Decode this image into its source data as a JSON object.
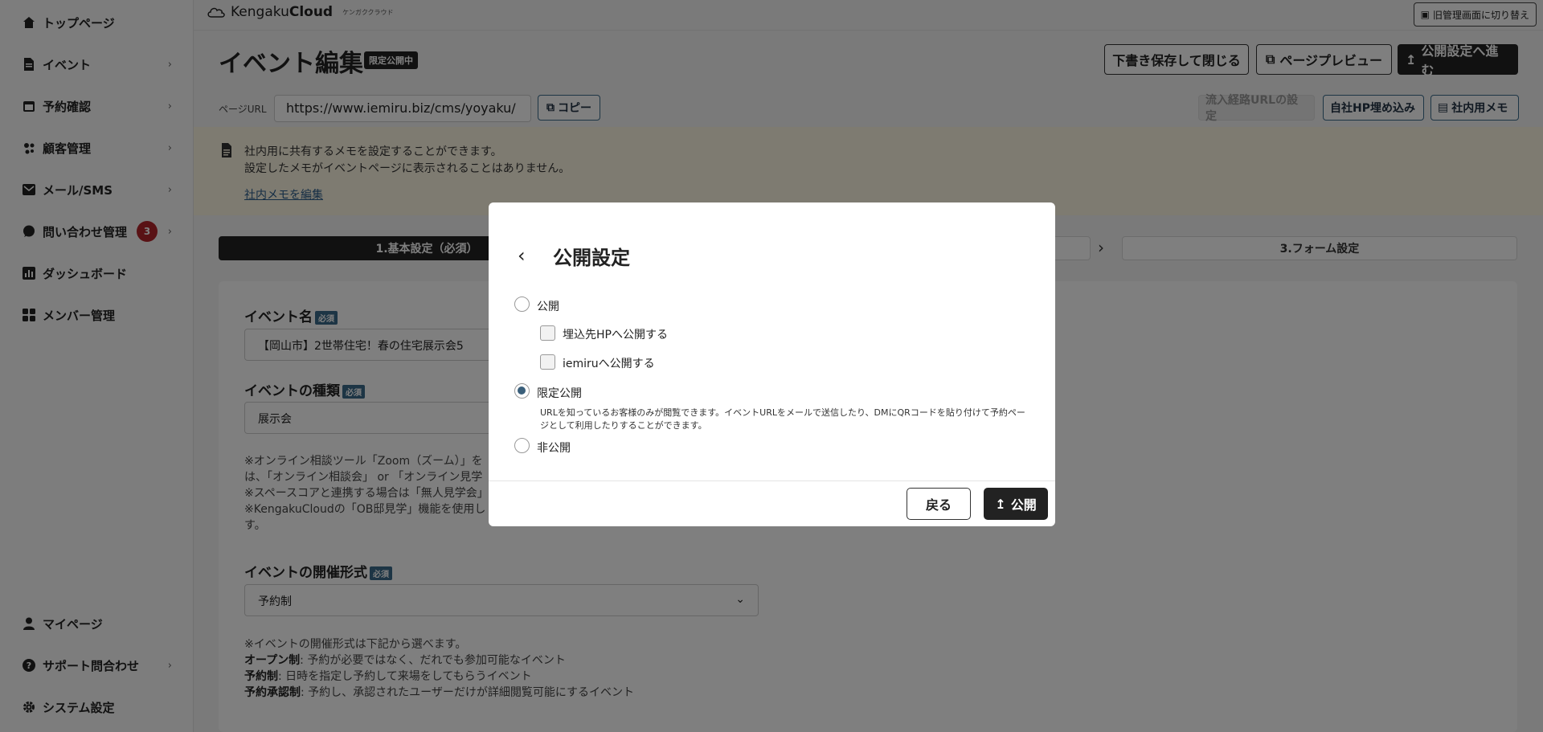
{
  "sidebar": {
    "items": [
      {
        "label": "トップページ",
        "icon": "home-icon"
      },
      {
        "label": "イベント",
        "icon": "document-icon"
      },
      {
        "label": "予約確認",
        "icon": "calendar-icon"
      },
      {
        "label": "顧客管理",
        "icon": "users-icon"
      },
      {
        "label": "メール/SMS",
        "icon": "mail-icon"
      },
      {
        "label": "問い合わせ管理",
        "icon": "chat-icon",
        "badge": "3"
      },
      {
        "label": "ダッシュボード",
        "icon": "chart-icon"
      },
      {
        "label": "メンバー管理",
        "icon": "grid-icon"
      }
    ],
    "bottom_items": [
      {
        "label": "マイページ",
        "icon": "person-icon"
      },
      {
        "label": "サポート問合わせ",
        "icon": "help-icon"
      },
      {
        "label": "システム設定",
        "icon": "gear-icon"
      }
    ]
  },
  "topbar": {
    "logo_text": "Kengaku",
    "logo_bold": "Cloud",
    "logo_kana": "ケンガククラウド",
    "switch_label": "旧管理画面に切り替え"
  },
  "header": {
    "title": "イベント編集",
    "status_badge": "限定公開中",
    "save_close": "下書き保存して閉じる",
    "preview": "ページプレビュー",
    "proceed": "公開設定へ進む"
  },
  "url_row": {
    "label": "ページURL",
    "url": "https://www.iemiru.biz/cms/yoyaku/",
    "copy": "コピー",
    "inflow": "流入経路URLの設定",
    "embed": "自社HP埋め込み",
    "memo": "社内用メモ"
  },
  "memo": {
    "line1": "社内用に共有するメモを設定することができます。",
    "line2": "設定したメモがイベントページに表示されることはありません。",
    "link": "社内メモを編集"
  },
  "steps": {
    "step1": "1.基本設定（必須）",
    "step3": "3.フォーム設定"
  },
  "form": {
    "required": "必須",
    "event_name_label": "イベント名",
    "event_name_value": "【岡山市】2世帯住宅！春の住宅展示会5",
    "event_type_label": "イベントの種類",
    "event_type_value": "展示会",
    "type_notes": [
      "※オンライン相談ツール「Zoom（ズーム）」を",
      "は、「オンライン相談会」 or 「オンライン見学",
      "※スペースコアと連携する場合は「無人見学会」",
      "※KengakuCloudの「OB邸見学」機能を使用し",
      "す。"
    ],
    "format_label": "イベントの開催形式",
    "format_value": "予約制",
    "format_note": "※イベントの開催形式は下記から選べます。",
    "formats": [
      {
        "name": "オープン制",
        "desc": ": 予約が必要ではなく、だれでも参加可能なイベント"
      },
      {
        "name": "予約制",
        "desc": ": 日時を指定し予約して来場をしてもらうイベント"
      },
      {
        "name": "予約承認制",
        "desc": ": 予約し、承認されたユーザーだけが詳細閲覧可能にするイベント"
      }
    ]
  },
  "modal": {
    "title": "公開設定",
    "option_public": "公開",
    "check_embed": "埋込先HPへ公開する",
    "check_iemiru": "iemiruへ公開する",
    "option_limited": "限定公開",
    "limited_desc": "URLを知っているお客様のみが閲覧できます。イベントURLをメールで送信したり、DMにQRコードを貼り付けて予約ページとして利用したりすることができます。",
    "option_private": "非公開",
    "back": "戻る",
    "publish": "公開"
  }
}
